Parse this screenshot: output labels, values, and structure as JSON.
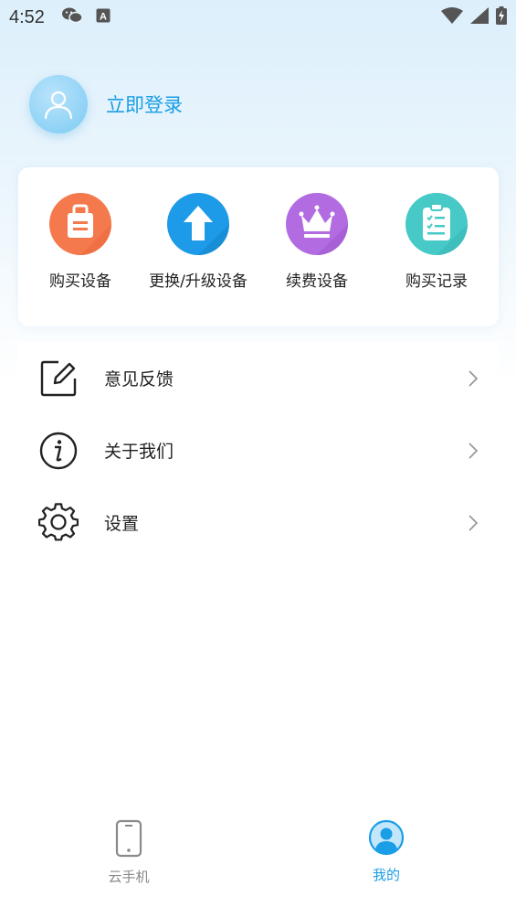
{
  "status_bar": {
    "time": "4:52"
  },
  "profile": {
    "login_label": "立即登录"
  },
  "quick_actions": [
    {
      "label": "购买设备",
      "icon": "shopping-bag-icon",
      "color": "#f47a4d"
    },
    {
      "label": "更换/升级设备",
      "icon": "upgrade-arrow-icon",
      "color": "#1d9be8"
    },
    {
      "label": "续费设备",
      "icon": "crown-icon",
      "color": "#b26be0"
    },
    {
      "label": "购买记录",
      "icon": "clipboard-checklist-icon",
      "color": "#46c9c7"
    }
  ],
  "menu": [
    {
      "label": "意见反馈",
      "icon": "edit-feedback-icon"
    },
    {
      "label": "关于我们",
      "icon": "info-icon"
    },
    {
      "label": "设置",
      "icon": "gear-icon"
    }
  ],
  "tabbar": {
    "tabs": [
      {
        "label": "云手机",
        "icon": "phone-icon",
        "active": false
      },
      {
        "label": "我的",
        "icon": "user-profile-icon",
        "active": true
      }
    ],
    "active_color": "#1a9ee6",
    "inactive_color": "#888888"
  }
}
